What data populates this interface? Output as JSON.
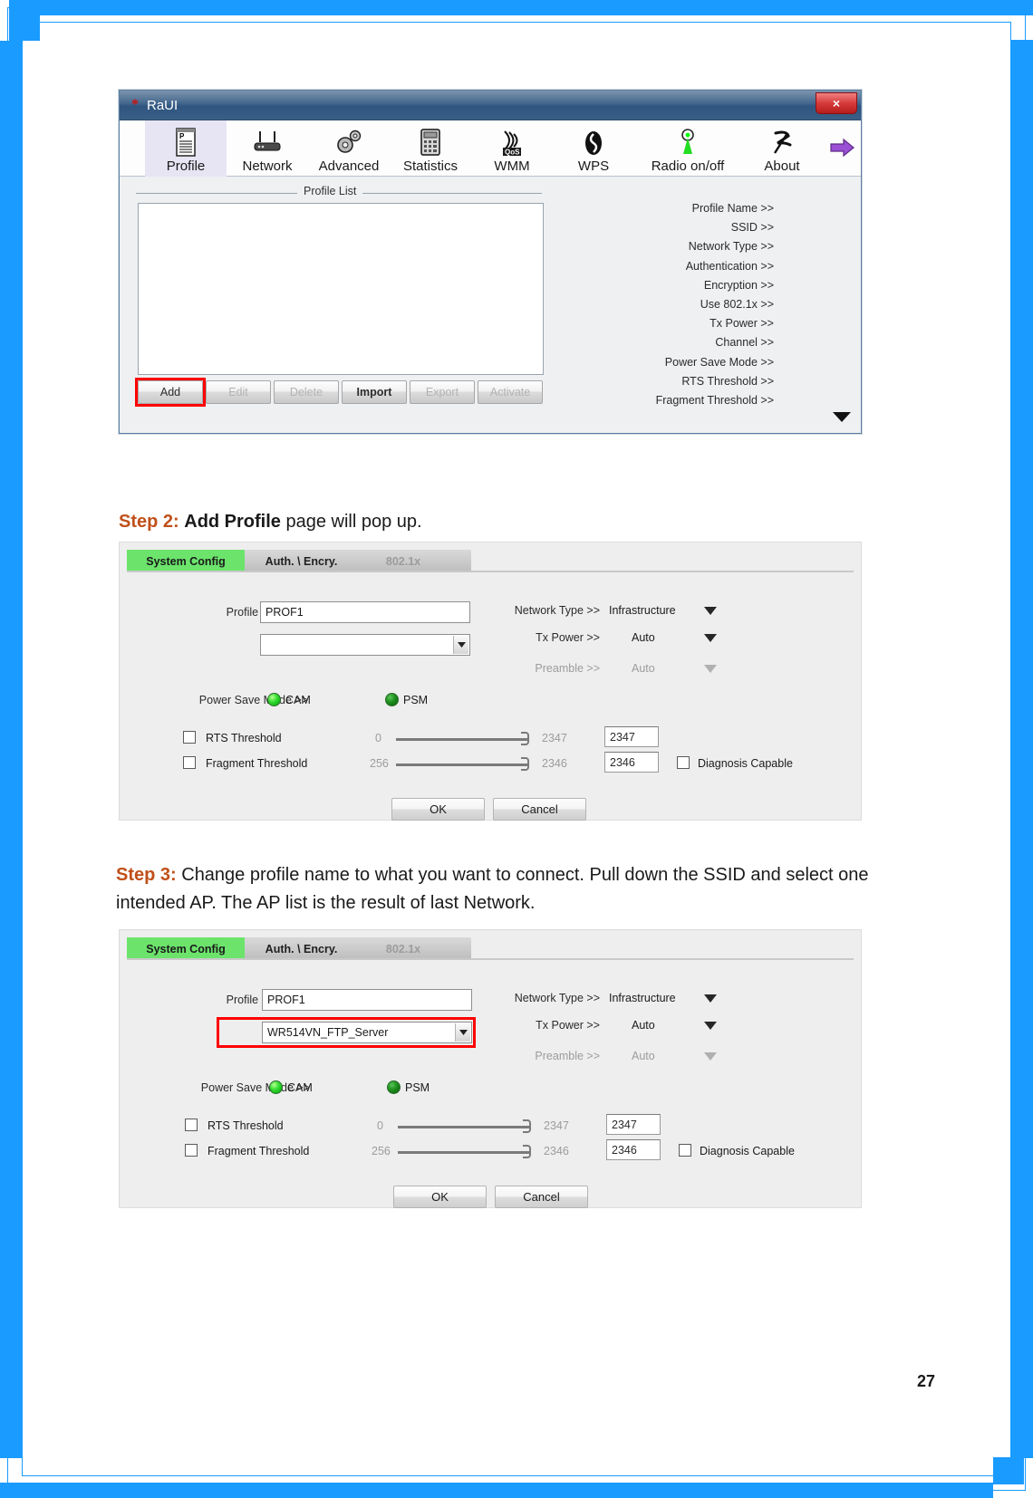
{
  "page": {
    "number": "27"
  },
  "raui_window": {
    "title": "RaUI",
    "title_icon": "raui-logo-icon",
    "close_label": "×",
    "toolbar": [
      {
        "label": "Profile",
        "icon": "profile-icon",
        "selected": true
      },
      {
        "label": "Network",
        "icon": "network-router-icon",
        "selected": false
      },
      {
        "label": "Advanced",
        "icon": "gears-icon",
        "selected": false
      },
      {
        "label": "Statistics",
        "icon": "statistics-icon",
        "selected": false
      },
      {
        "label": "WMM",
        "icon": "wmm-qos-icon",
        "selected": false
      },
      {
        "label": "WPS",
        "icon": "wps-icon",
        "selected": false
      },
      {
        "label": "Radio on/off",
        "icon": "radio-antenna-icon",
        "selected": false
      },
      {
        "label": "About",
        "icon": "about-icon",
        "selected": false
      }
    ],
    "toolbar_more_icon": "purple-right-arrow-icon",
    "group_label": "Profile List",
    "buttons": [
      {
        "label": "Add",
        "state": "highlighted"
      },
      {
        "label": "Edit",
        "state": "disabled"
      },
      {
        "label": "Delete",
        "state": "disabled"
      },
      {
        "label": "Import",
        "state": "enabled"
      },
      {
        "label": "Export",
        "state": "disabled"
      },
      {
        "label": "Activate",
        "state": "disabled"
      }
    ],
    "info_labels": [
      "Profile Name >>",
      "SSID >>",
      "Network Type >>",
      "Authentication >>",
      "Encryption >>",
      "Use 802.1x >>",
      "Tx Power >>",
      "Channel >>",
      "Power Save Mode >>",
      "RTS Threshold >>",
      "Fragment Threshold >>"
    ],
    "scroll_down_icon": "triangle-down-icon"
  },
  "step2": {
    "prefix": "Step 2:",
    "bold": "Add Profile",
    "rest": " page will pop up."
  },
  "step3": {
    "prefix": "Step 3:",
    "line1": " Change profile name to what you want to connect. Pull down the SSID and select one",
    "line2": "intended AP. The AP list is the result of last Network."
  },
  "dialog": {
    "tabs": [
      {
        "label": "System Config",
        "state": "active"
      },
      {
        "label": "Auth. \\ Encry.",
        "state": "idle"
      },
      {
        "label": "802.1x",
        "state": "disabled"
      }
    ],
    "profile_name_label": "Profile Name >>",
    "profile_name_value": "PROF1",
    "ssid_label": "SSID >>",
    "ssid_value_step2": "",
    "ssid_value_step3": "WR514VN_FTP_Server",
    "network_type_label": "Network Type >>",
    "network_type_value": "Infrastructure",
    "tx_power_label": "Tx Power >>",
    "tx_power_value": "Auto",
    "preamble_label": "Preamble >>",
    "preamble_value": "Auto",
    "power_save_label": "Power Save Mode >>",
    "cam_label": "CAM",
    "psm_label": "PSM",
    "rts_label": "RTS Threshold",
    "rts_min": "0",
    "rts_max": "2347",
    "rts_value": "2347",
    "frag_label": "Fragment Threshold",
    "frag_min": "256",
    "frag_max": "2346",
    "frag_value": "2346",
    "diagnosis_label": "Diagnosis Capable",
    "ok_label": "OK",
    "cancel_label": "Cancel"
  },
  "colors": {
    "page_border": "#1a9bff",
    "highlight_red": "#ff0000",
    "tab_active_green": "#6ce46c",
    "step_number": "#c0501a"
  }
}
